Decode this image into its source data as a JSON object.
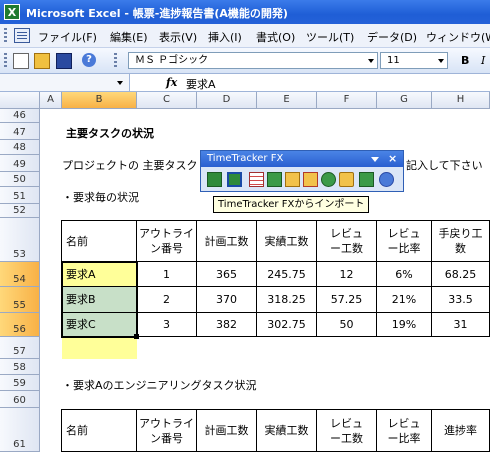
{
  "window": {
    "title": "Microsoft Excel - 帳票-進捗報告書(A機能の開発)"
  },
  "menu": [
    "ファイル(F)",
    "編集(E)",
    "表示(V)",
    "挿入(I)",
    "書式(O)",
    "ツール(T)",
    "データ(D)",
    "ウィンドウ(W)"
  ],
  "toolbar": {
    "font_name": "ＭＳ Ｐゴシック",
    "font_size": "11",
    "bold": "B",
    "italic": "I"
  },
  "formula_bar": {
    "fx": "fx",
    "content": "要求A"
  },
  "columns": [
    "A",
    "B",
    "C",
    "D",
    "E",
    "F",
    "G",
    "H"
  ],
  "rows": [
    "46",
    "47",
    "48",
    "49",
    "50",
    "51",
    "52",
    "53",
    "54",
    "55",
    "56",
    "57",
    "58",
    "59",
    "60",
    "61"
  ],
  "sheet": {
    "section_title": "主要タスクの状況",
    "intro_left": "プロジェクトの 主要タスク",
    "intro_right": "記入して下さい",
    "sub_heading_1": "・要求毎の状況",
    "sub_heading_2": "・要求Aのエンジニアリングタスク状況"
  },
  "table1": {
    "headers": [
      "名前",
      "アウトライン番号",
      "計画工数",
      "実績工数",
      "レビュー工数",
      "レビュー比率",
      "手戻り工数"
    ],
    "rows": [
      [
        "要求A",
        "1",
        "365",
        "245.75",
        "12",
        "6%",
        "68.25"
      ],
      [
        "要求B",
        "2",
        "370",
        "318.25",
        "57.25",
        "21%",
        "33.5"
      ],
      [
        "要求C",
        "3",
        "382",
        "302.75",
        "50",
        "19%",
        "31"
      ]
    ]
  },
  "table2": {
    "headers": [
      "名前",
      "アウトライン番号",
      "計画工数",
      "実績工数",
      "レビュー工数",
      "レビュー比率",
      "進捗率"
    ]
  },
  "timetracker": {
    "title": "TimeTracker FX",
    "tooltip": "TimeTracker FXからインポート",
    "icons": [
      "export-icon",
      "import-icon",
      "grid-icon",
      "edit-icon",
      "add-icon",
      "delete-icon",
      "refresh-icon",
      "folder-icon",
      "download-icon",
      "help-icon"
    ]
  },
  "colors": {
    "title_bar": "#2461d8",
    "selection": "#f8b146",
    "highlight_yellow": "#ffff99",
    "highlight_green": "#c8e0c8"
  }
}
